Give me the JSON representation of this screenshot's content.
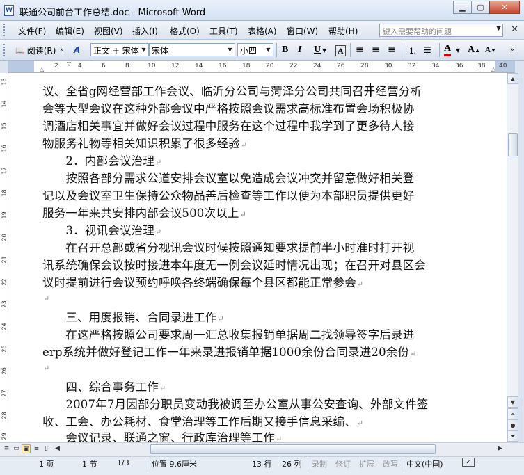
{
  "window": {
    "title": "联通公司前台工作总结.doc - Microsoft Word",
    "app_icon": "W"
  },
  "menu": {
    "items": [
      "文件(F)",
      "编辑(E)",
      "视图(V)",
      "插入(I)",
      "格式(O)",
      "工具(T)",
      "表格(A)",
      "窗口(W)",
      "帮助(H)"
    ],
    "help_placeholder": "键入需要帮助的问题"
  },
  "toolbar": {
    "reading_label": "阅读(R)",
    "style_value": "正文 + 宋体",
    "font_value": "宋体",
    "size_value": "小四",
    "bold": "B",
    "italic": "I",
    "underline": "U",
    "charborder": "A",
    "font_color": "A",
    "grow_font": "A",
    "shrink_font": "A"
  },
  "ruler": {
    "numbers": [
      "2",
      "4",
      "6",
      "8",
      "10",
      "12",
      "14",
      "16",
      "18",
      "20",
      "22",
      "24",
      "26",
      "28",
      "30",
      "32",
      "34",
      "36",
      "38",
      "40"
    ]
  },
  "vruler": {
    "numbers": [
      "13",
      "14",
      "15",
      "16",
      "17",
      "18",
      "19",
      "20",
      "21",
      "22",
      "23",
      "24",
      "25",
      "26",
      "27",
      "28",
      "29"
    ]
  },
  "document": {
    "lines": [
      {
        "text": "议、全省g网经营部工作会议、临沂分公司与菏泽分公司共同召开经营分析",
        "mark": ""
      },
      {
        "text": "会等大型会议在这种外部会议中严格按照会议需求高标准布置会场积极协",
        "mark": ""
      },
      {
        "text": "调酒店相关事宜并做好会议过程中服务在这个过程中我学到了更多待人接",
        "mark": ""
      },
      {
        "text": "物服务礼物等相关知识积累了很多经验",
        "mark": "↵"
      },
      {
        "text": "　　2．内部会议治理",
        "mark": "↵"
      },
      {
        "text": "　　按照各部分需求公道安排会议室以免造成会议冲突并留意做好相关登",
        "mark": ""
      },
      {
        "text": "记以及会议室卫生保持公众物品善后检查等工作以便为本部职员提供更好",
        "mark": ""
      },
      {
        "text": "服务一年来共安排内部会议500次以上",
        "mark": "↵"
      },
      {
        "text": "　　3．视讯会议治理",
        "mark": "↵"
      },
      {
        "text": "　　在召开总部或省分视讯会议时候按照通知要求提前半小时准时打开视",
        "mark": ""
      },
      {
        "text": "讯系统确保会议按时接进本年度无一例会议延时情况出现；在召开对县区会",
        "mark": ""
      },
      {
        "text": "议时提前进行会议预约呼唤各终端确保每个县区都能正常参会",
        "mark": "↵"
      },
      {
        "text": "",
        "mark": "↵"
      },
      {
        "text": "　　三、用度报销、合同录进工作",
        "mark": "↵"
      },
      {
        "text": "　　在这严格按照公司要求周一汇总收集报销单据周二找领导签字后录进",
        "mark": ""
      },
      {
        "text": "erp系统并做好登记工作一年来录进报销单据1000余份合同录进20余份",
        "mark": "↵"
      },
      {
        "text": "",
        "mark": "↵"
      },
      {
        "text": "　　四、综合事务工作",
        "mark": "↵"
      },
      {
        "text": "　　2007年7月因部分职员变动我被调至办公室从事公安查询、外部文件签",
        "mark": ""
      },
      {
        "text": "收、工会、办公耗材、食堂治理等工作后期又接手信息采编、",
        "mark": "↵"
      },
      {
        "text": "　　会议记录、联通之窗、行政库治理等工作",
        "mark": "↵"
      }
    ]
  },
  "status": {
    "page": "1 页",
    "section": "1 节",
    "page_of": "1/3",
    "position": "位置 9.6厘米",
    "line": "13 行",
    "column": "26 列",
    "rec": "录制",
    "trk": "修订",
    "ext": "扩展",
    "ovr": "改写",
    "language": "中文(中国)"
  }
}
